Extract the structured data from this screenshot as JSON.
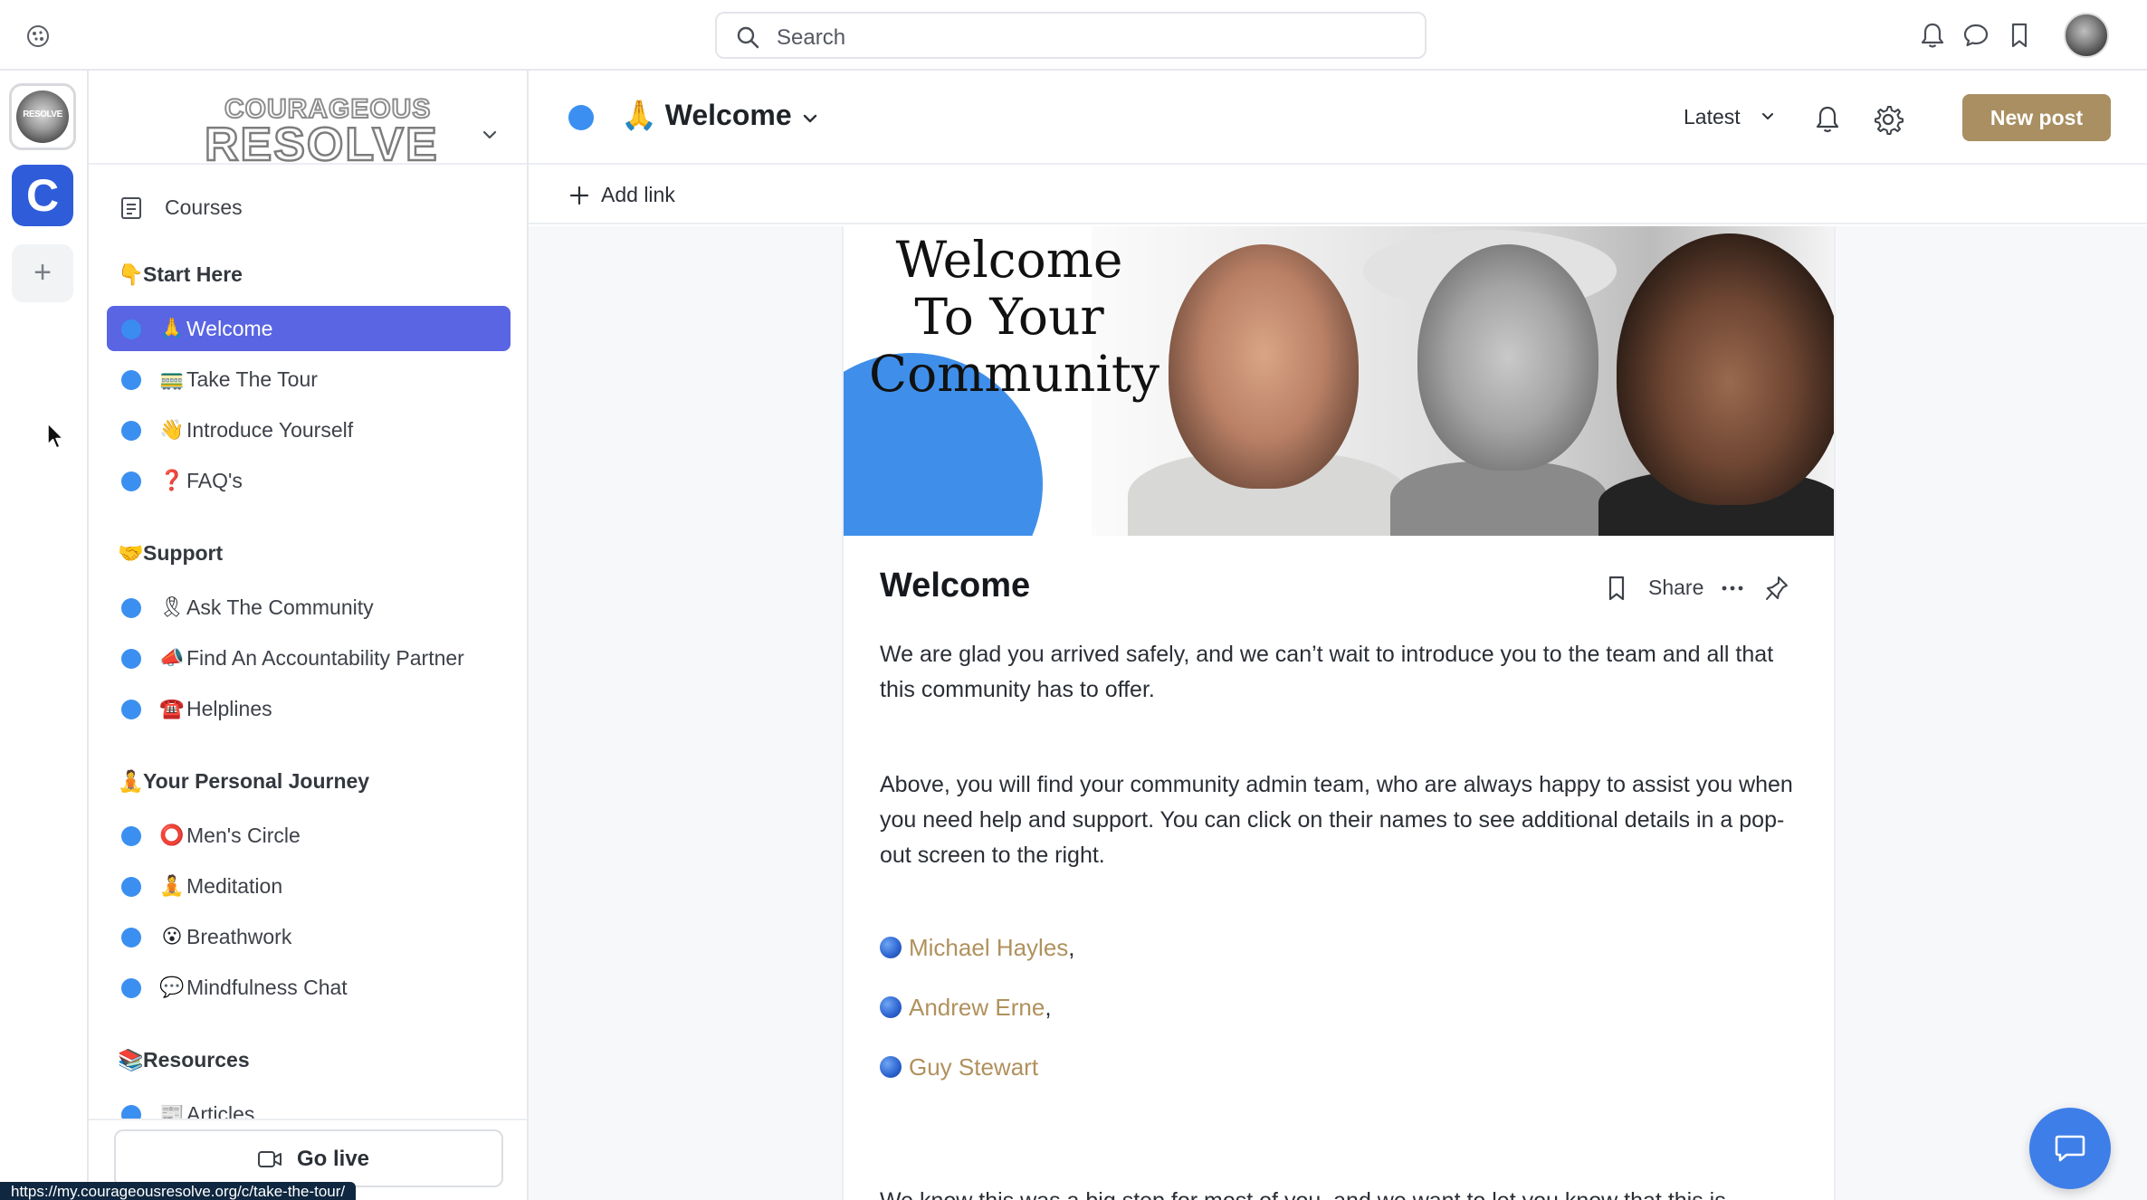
{
  "topbar": {
    "search_placeholder": "Search",
    "icons": [
      "globe-icon",
      "search-icon",
      "bell-icon",
      "chat-icon",
      "bookmark-icon",
      "avatar"
    ]
  },
  "rail": {
    "logo_text": "RESOLVE",
    "community_letter": "C",
    "add_label": "+"
  },
  "sidebar": {
    "brand_top": "COURAGEOUS",
    "brand_main": "RESOLVE",
    "courses_label": "Courses",
    "sections": [
      {
        "title": "Start Here",
        "emoji": "👇",
        "items": [
          {
            "emoji": "🙏",
            "label": "Welcome",
            "active": true
          },
          {
            "emoji": "🚃",
            "label": "Take The Tour"
          },
          {
            "emoji": "👋",
            "label": "Introduce Yourself"
          },
          {
            "emoji": "❓",
            "label": "FAQ's"
          }
        ]
      },
      {
        "title": "Support",
        "emoji": "🤝",
        "items": [
          {
            "emoji": "🎗",
            "label": "Ask The Community"
          },
          {
            "emoji": "📣",
            "label": "Find An Accountability Partner"
          },
          {
            "emoji": "☎️",
            "label": "Helplines"
          }
        ]
      },
      {
        "title": "Your Personal Journey",
        "emoji": "🧘",
        "items": [
          {
            "emoji": "⭕",
            "label": "Men's Circle"
          },
          {
            "emoji": "🧘",
            "label": "Meditation"
          },
          {
            "emoji": "😮",
            "label": "Breathwork"
          },
          {
            "emoji": "💬",
            "label": "Mindfulness Chat"
          }
        ]
      },
      {
        "title": "Resources",
        "emoji": "📚",
        "items": [
          {
            "emoji": "📰",
            "label": "Articles"
          }
        ]
      }
    ],
    "go_live_label": "Go live"
  },
  "status_url": "https://my.courageousresolve.org/c/take-the-tour/",
  "header": {
    "emoji": "🙏",
    "title": "Welcome",
    "sort_label": "Latest",
    "new_post_label": "New post",
    "add_link_label": "Add link"
  },
  "post": {
    "banner_text": "Welcome To Your Community",
    "title": "Welcome",
    "share_label": "Share",
    "paragraphs": [
      "We are glad you arrived safely, and we can’t wait to introduce you to the team and all that this community has to offer.",
      "Above, you will find your community admin team, who are always happy to assist you when you need help and support.  You can click on their names to see additional details in a pop-out screen to the right.",
      "We know this was a big step for most of you, and we want to let you know that this is"
    ],
    "admins": [
      {
        "name": "Michael Hayles",
        "suffix": ","
      },
      {
        "name": "Andrew Erne",
        "suffix": ","
      },
      {
        "name": "Guy Stewart",
        "suffix": ""
      }
    ]
  },
  "colors": {
    "accent": "#5965e3",
    "dot": "#3b8ff0",
    "new_post": "#a98f62",
    "admin_link": "#b0915d",
    "chat_fab": "#3e7ee8"
  }
}
